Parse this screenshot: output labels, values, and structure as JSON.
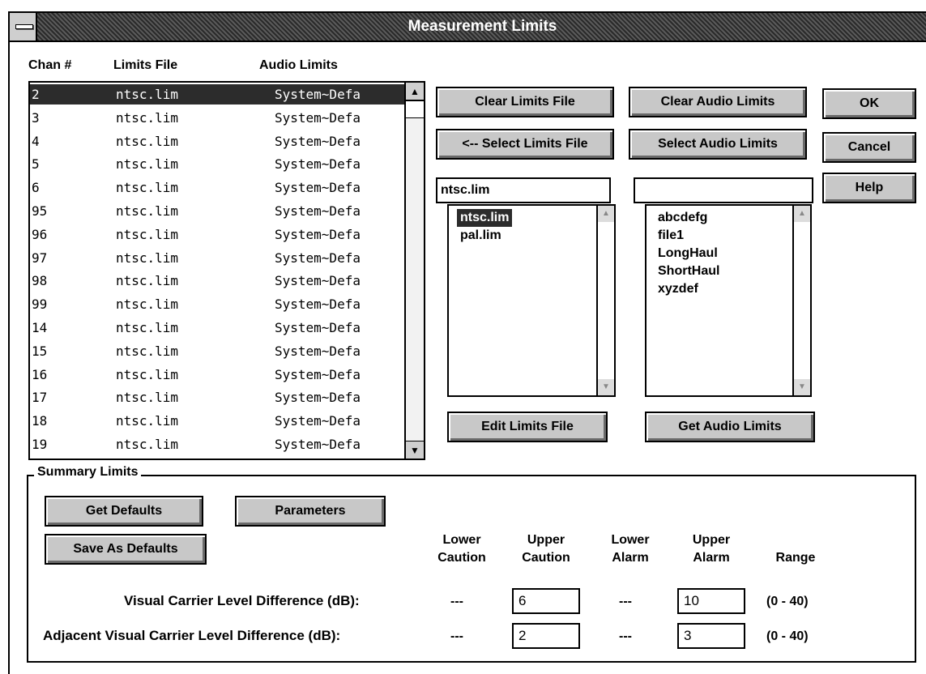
{
  "window": {
    "title": "Measurement Limits"
  },
  "channels": {
    "headers": {
      "chan": "Chan #",
      "limits_file": "Limits File",
      "audio_limits": "Audio Limits"
    },
    "rows": [
      {
        "chan": "2",
        "file": "ntsc.lim",
        "audio": "System~Defa"
      },
      {
        "chan": "3",
        "file": "ntsc.lim",
        "audio": "System~Defa"
      },
      {
        "chan": "4",
        "file": "ntsc.lim",
        "audio": "System~Defa"
      },
      {
        "chan": "5",
        "file": "ntsc.lim",
        "audio": "System~Defa"
      },
      {
        "chan": "6",
        "file": "ntsc.lim",
        "audio": "System~Defa"
      },
      {
        "chan": "95",
        "file": "ntsc.lim",
        "audio": "System~Defa"
      },
      {
        "chan": "96",
        "file": "ntsc.lim",
        "audio": "System~Defa"
      },
      {
        "chan": "97",
        "file": "ntsc.lim",
        "audio": "System~Defa"
      },
      {
        "chan": "98",
        "file": "ntsc.lim",
        "audio": "System~Defa"
      },
      {
        "chan": "99",
        "file": "ntsc.lim",
        "audio": "System~Defa"
      },
      {
        "chan": "14",
        "file": "ntsc.lim",
        "audio": "System~Defa"
      },
      {
        "chan": "15",
        "file": "ntsc.lim",
        "audio": "System~Defa"
      },
      {
        "chan": "16",
        "file": "ntsc.lim",
        "audio": "System~Defa"
      },
      {
        "chan": "17",
        "file": "ntsc.lim",
        "audio": "System~Defa"
      },
      {
        "chan": "18",
        "file": "ntsc.lim",
        "audio": "System~Defa"
      },
      {
        "chan": "19",
        "file": "ntsc.lim",
        "audio": "System~Defa"
      }
    ],
    "selected_index": 0
  },
  "buttons": {
    "clear_limits_file": "Clear Limits File",
    "clear_audio_limits": "Clear Audio Limits",
    "ok": "OK",
    "select_limits_file": "<-- Select Limits File",
    "select_audio_limits": "Select Audio Limits",
    "cancel": "Cancel",
    "help": "Help",
    "edit_limits_file": "Edit Limits File",
    "get_audio_limits": "Get Audio Limits",
    "get_defaults": "Get Defaults",
    "parameters": "Parameters",
    "save_as_defaults": "Save As Defaults"
  },
  "limits_file_picker": {
    "value": "ntsc.lim",
    "items": [
      "ntsc.lim",
      "pal.lim"
    ],
    "selected_index": 0
  },
  "audio_limits_picker": {
    "value": "",
    "items": [
      "abcdefg",
      "file1",
      "LongHaul",
      "ShortHaul",
      "xyzdef"
    ]
  },
  "summary": {
    "group_label": "Summary Limits",
    "columns": {
      "lower_caution": [
        "Lower",
        "Caution"
      ],
      "upper_caution": [
        "Upper",
        "Caution"
      ],
      "lower_alarm": [
        "Lower",
        "Alarm"
      ],
      "upper_alarm": [
        "Upper",
        "Alarm"
      ],
      "range": "Range"
    },
    "rows": [
      {
        "label": "Visual Carrier Level Difference (dB):",
        "lower_caution": "---",
        "upper_caution": "6",
        "lower_alarm": "---",
        "upper_alarm": "10",
        "range": "(0 - 40)"
      },
      {
        "label": "Adjacent Visual Carrier Level Difference (dB):",
        "lower_caution": "---",
        "upper_caution": "2",
        "lower_alarm": "---",
        "upper_alarm": "3",
        "range": "(0 - 40)"
      }
    ]
  },
  "colors": {
    "selection": "#2c2c2c",
    "button_face": "#c8c8c8",
    "title_bar": "#3a3a3a"
  }
}
